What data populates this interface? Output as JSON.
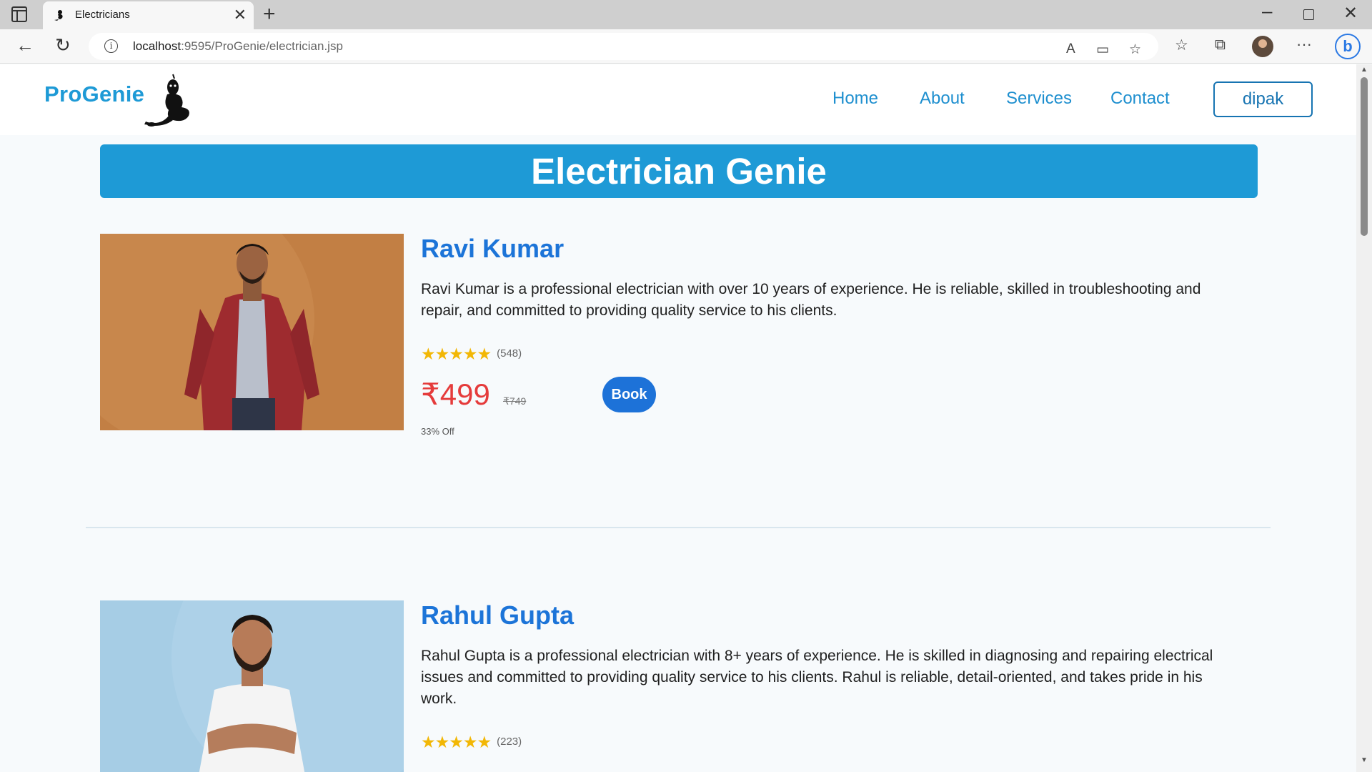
{
  "browser": {
    "tab_title": "Electricians",
    "tab_close": "✕",
    "new_tab": "+",
    "url_host": "localhost",
    "url_rest": ":9595/ProGenie/electrician.jsp",
    "icons": [
      "sidebar-icon",
      "back-arrow-icon",
      "reload-icon",
      "info-icon",
      "read-aloud-icon",
      "immersive-reader-icon",
      "add-favorite-icon",
      "favorites-icon",
      "collections-icon",
      "profile-avatar",
      "more-icon",
      "copilot-icon"
    ]
  },
  "site": {
    "brand": "ProGenie",
    "nav": {
      "home": "Home",
      "about": "About",
      "services": "Services",
      "contact": "Contact"
    },
    "user": "dipak"
  },
  "banner": {
    "title": "Electrician Genie"
  },
  "electricians": [
    {
      "name": "Ravi Kumar",
      "description": "Ravi Kumar is a professional electrician with over 10 years of experience. He is reliable, skilled in troubleshooting and repair, and committed to providing quality service to his clients.",
      "stars": "★★★★★",
      "reviews": "(548)",
      "price": "₹499",
      "old_price": "₹749",
      "book_label": "Book",
      "discount": "33% Off"
    },
    {
      "name": "Rahul Gupta",
      "description": "Rahul Gupta is a professional electrician with 8+ years of experience. He is skilled in diagnosing and repairing electrical issues and committed to providing quality service to his clients. Rahul is reliable, detail-oriented, and takes pride in his work.",
      "stars": "★★★★★",
      "reviews": "(223)"
    }
  ],
  "colors": {
    "brand": "#1e9ad6",
    "name": "#1c74d8",
    "price": "#e53b3b",
    "star": "#f2b705"
  }
}
